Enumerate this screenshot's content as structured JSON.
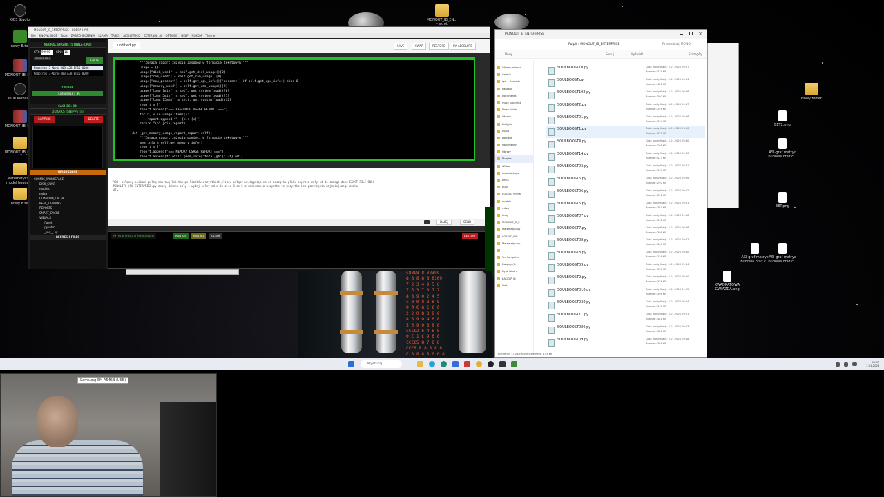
{
  "desktop": {
    "left_icons": [
      {
        "label": "OBS Studio",
        "type": "app"
      },
      {
        "label": "nowy 8.txt",
        "type": "green"
      },
      {
        "label": "MONOUT_IB_EN...",
        "type": "rar"
      },
      {
        "label": "Iriun Webcam",
        "type": "app"
      },
      {
        "label": "MONOUT_IB_EN...",
        "type": "rar"
      },
      {
        "label": "MONOUT_IB_EN...",
        "type": "folder"
      },
      {
        "label": "Matematyczny model bogów ...",
        "type": "folder"
      },
      {
        "label": "nowy 8.txt",
        "type": "folder"
      }
    ],
    "top_icon": "MONOUT_IB_EN... - skrót",
    "right_icons": [
      {
        "label": "Nowy folder",
        "type": "folder"
      },
      {
        "label": "EET2.png",
        "type": "file"
      },
      {
        "label": "ASI-graf matryc budowa oraz c...",
        "type": "file"
      },
      {
        "label": "EET.png",
        "type": "file"
      },
      {
        "label": "ASI-graf matryc budowa oraz c...",
        "type": "file"
      },
      {
        "label": "ASI-graf matryc budowa oraz c...",
        "type": "file"
      },
      {
        "label": "KWADRATOWA GWIAZDA.png",
        "type": "file"
      }
    ]
  },
  "editor": {
    "title": "MONOUT_IB_ENTERPRISE - COBRA-HIVE",
    "menu": [
      "File",
      "KNOWLEDGE",
      "Tools",
      "ZABEZPIECZENIA",
      "LLAMA",
      "TASKS",
      "AKSILITRIC0",
      "EXTERNAL_AI",
      "OPTIONS",
      "HELP",
      "NUKOM",
      "Theme"
    ],
    "engine_header": "NEURAL ENGINE [STABLE-CPU]",
    "ctx_label": "CTX:",
    "ctx_value": "99999",
    "cpu_label": "CPU:",
    "cpu_value": "16",
    "stable_tag": "STABLE CPU",
    "ignite": "IGNITE",
    "models": [
      "Nemotron-3-Nano-30B-A3B-BF16-0000",
      "Nemotron-3-Nano-30B-A3B-BF16-0000"
    ],
    "online": "ONLINE",
    "loading": "Ładowanie: 0%",
    "cached": "CACHED: ON",
    "quarks": "QUARKS (SNIPPETS)",
    "capture": "CAPTURE",
    "delete": "DELETE",
    "workspace": "WORKSPACE",
    "tree": [
      "COSMIC_WORKSPACE",
      "DISK_SWAP",
      "models",
      "mózg",
      "QUANTUM_CACHE",
      "REAL_TRAINING",
      "REPORTS",
      "SMART_CACHE",
      "VISUALS",
      ".flake8",
      ".pylintrc",
      "__init__.py"
    ],
    "refresh": "REFRESH FILES",
    "tab": "untitled.py",
    "toolbar": [
      "SAVE",
      "SWAP",
      "RESTORE",
      "PY: ABSOLUTE"
    ],
    "code": [
      "        \"\"\"Zwraca raport zużycia zasobów w formacie tekstowym.\"\"\"",
      "        usage = {}",
      "        usage[\"disk_used\"] = self.get_disk_usage()[0]",
      "        usage[\"ram_used\"] = self.get_ram_usage()[0]",
      "        usage[\"cpu_percent\"] = self.get_cpu_info()['percent'] if self.get_cpu_info() else 0",
      "        usage[\"memory_used\"] = self.get_ram_usage()[2]",
      "        usage[\"load_1min\"] = self._get_system_load()[0]",
      "        usage[\"load_5min\"] = self._get_system_load()[1]",
      "        usage[\"load_15min\"] = self._get_system_load()[2]",
      "        report = []",
      "        report.append(\"=== RESOURCE USAGE REPORT ===\")",
      "        for k, v in usage.items():",
      "            report.append(f\"  {k}: {v}\")",
      "        return \"\\n\".join(report)",
      "",
      "    def _get_memory_usage_report_report(self):",
      "        \"\"\"Zwraca raport zużycia pamięci w formacie tekstowym.\"\"\"",
      "        mem_info = self.get_memory_info()",
      "        report = []",
      "        report.append(\"=== MEMORY USAGE REPORT ===\")",
      "        report.append(f\"Total: {mem_info['total_gb']:.2f} GB\")"
    ],
    "log": [
      "YOU: połączy plikami pełną naprawą lilitka po limitów wszystkich plików połącz wyciągnięciem od początku pliku poprzez cały od do samego dołu EXACT FILE ONLY",
      "MONOLITH (M) ENTERPRISE.py zmazy dokonu cały i wydaj pełny od a do z od 0 do 5 z zmieszania wszystko to wszystko bez pominięcia najmniejszego znaku",
      "AI>"
    ],
    "log_buttons": [
      "DALEJ",
      "SEND"
    ],
    "shell": {
      "title": "PYTHON SHELL [THREAD SAFE]",
      "run_sel": "RUN SEL",
      "run_all": "RUN ALL",
      "clear": "CLEAR",
      "restart": "RESTART"
    }
  },
  "explorer": {
    "title": "MONOUT_IB_ENTERPRISE",
    "path": [
      "Pulpit",
      "MONOUT_IB_ENTERPRISE"
    ],
    "search_placeholder": "Przeszukaj: MONO",
    "tools": [
      "Nowy",
      "Sortuj",
      "Wyświetl",
      "Szczegóły"
    ],
    "nav": [
      "Główny elemen",
      "Galeria",
      "Igor - Osobiste",
      "Desktop",
      "Documents",
      "moce super int",
      "Nowy folder",
      "Obrazy",
      "Zadjęcia",
      "Pulpit",
      "Pobrane",
      "Dokumenty",
      "Obrazy",
      "Muzyka",
      "Wideo",
      "Auto backups",
      "bests",
      "build",
      "COSMIC_WORK",
      "models",
      "mózg",
      "testy",
      "MONOUT_IB_E",
      "Matematyczny",
      "COSMIC_WO",
      "Matematyczny",
      "",
      "Ten komputer",
      "Dołączy (C:)",
      "Dysk lokalny",
      "BACKUP (E:)",
      "Sieć"
    ],
    "files": [
      {
        "name": "SOULBOOST10.py",
        "date": "Data modyfikacji: 5.01.2026 09:27",
        "size": "Rozmiar: 375 KB"
      },
      {
        "name": "SOULBOOST.py",
        "date": "Data modyfikacji: 5.01.2026 23:04",
        "size": "Rozmiar: 421 KB"
      },
      {
        "name": "SOULBOOST102.py",
        "date": "Data modyfikacji: 5.01.2026 09:26",
        "size": "Rozmiar: 390 KB"
      },
      {
        "name": "SOULBOOST2.py",
        "date": "Data modyfikacji: 4.01.2026 20:47",
        "size": "Rozmiar: 256 KB"
      },
      {
        "name": "SOULBOOST01.py",
        "date": "Data modyfikacji: 5.01.2026 09:26",
        "size": "Rozmiar: 374 KB"
      },
      {
        "name": "SOULBOOST1.py",
        "date": "Data modyfikacji: 4.01.2026 23:00",
        "size": "Rozmiar: 375 KB"
      },
      {
        "name": "SOULBOOST4.py",
        "date": "Data modyfikacji: 5.01.2026 09:30",
        "size": "Rozmiar: 206 KB"
      },
      {
        "name": "SOULBOOST14.py",
        "date": "Data modyfikacji: 5.01.2026 09:30",
        "size": "Rozmiar: 413 KB"
      },
      {
        "name": "SOULBOOST03.py",
        "date": "Data modyfikacji: 5.01.2026 09:41",
        "size": "Rozmiar: 395 KB"
      },
      {
        "name": "SOULBOOST5.py",
        "date": "Data modyfikacji: 5.01.2026 09:26",
        "size": "Rozmiar: 290 KB"
      },
      {
        "name": "SOULBOOST06.py",
        "date": "Data modyfikacji: 5.01.2026 09:52",
        "size": "Rozmiar: 391 KB"
      },
      {
        "name": "SOULBOOST6.py",
        "date": "Data modyfikacji: 5.01.2026 09:01",
        "size": "Rozmiar: 307 KB"
      },
      {
        "name": "SOULBOOST07.py",
        "date": "Data modyfikacji: 5.01.2026 09:08",
        "size": "Rozmiar: 392 KB"
      },
      {
        "name": "SOULBOOST7.py",
        "date": "Data modyfikacji: 5.01.2026 09:26",
        "size": "Rozmiar: 308 KB"
      },
      {
        "name": "SOULBOOST08.py",
        "date": "Data modyfikacji: 5.01.2026 09:37",
        "size": "Rozmiar: 306 KB"
      },
      {
        "name": "SOULBOOST8.py",
        "date": "Data modyfikacji: 5.01.2026 09:30",
        "size": "Rozmiar: 316 KB"
      },
      {
        "name": "SOULBOOST09.py",
        "date": "Data modyfikacji: 5.01.2026 09:34",
        "size": "Rozmiar: 398 KB"
      },
      {
        "name": "SOULBOOST9.py",
        "date": "Data modyfikacji: 5.01.2026 09:00",
        "size": "Rozmiar: 326 KB"
      },
      {
        "name": "SOULBOOST010.py",
        "date": "Data modyfikacji: 5.01.2026 09:22",
        "size": "Rozmiar: 396 KB"
      },
      {
        "name": "SOULBOOST030.py",
        "date": "Data modyfikacji: 5.01.2026 09:04",
        "size": "Rozmiar: 376 KB"
      },
      {
        "name": "SOULBOOST11.py",
        "date": "Data modyfikacji: 5.01.2026 09:21",
        "size": "Rozmiar: 381 KB"
      },
      {
        "name": "SOULBOOST080.py",
        "date": "Data modyfikacji: 5.01.2026 09:03",
        "size": "Rozmiar: 386 KB"
      },
      {
        "name": "SOULBOOST09.py",
        "date": "Data modyfikacji: 5.01.2026 09:08",
        "size": "Rozmiar: 398 KB"
      }
    ],
    "status": "Elementy: 37   Zaznaczony element: 1,54 KB"
  },
  "wallpaper_numbers": "€88€8 8 02399\n8 8 8 8 8 8169\n7 2 3 4 9 5 6\n7 5 3 7 8 7 7\n8 8 9 0 2 4 5\n€ 0 0 8 8 8 8\n0 0 € 8 € € 8\n2 2 0 8 8 8 €\n8 8 9 0 4 6 8\n5 5 9 0 8 8 8\n€€€€2 6 4 6 8\n0 € 1 € 9 8 8\n€€€€5 8 7 8 8\n€€€8 8 8 8 8 8\n€ 8 8 8 8 0 0 8",
  "taskbar": {
    "search": "Wyszukaj",
    "time": "09:37",
    "date": "7.01.2026"
  },
  "webcam": {
    "label": "Samsung SM-A546B (USB)"
  },
  "colors": {
    "accent_green": "#21c321",
    "ignite_red": "#c01a1a",
    "online_green": "#2d8a2d",
    "workspace_orange": "#c86a0a"
  }
}
